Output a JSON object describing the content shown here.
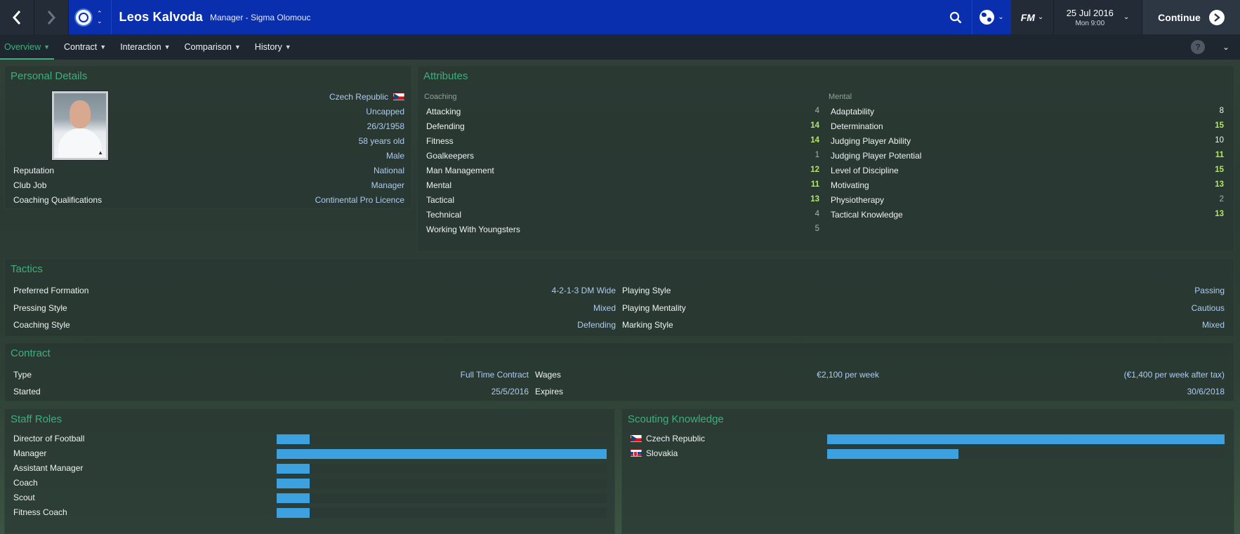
{
  "header": {
    "name": "Leos Kalvoda",
    "subtitle": "Manager - Sigma Olomouc",
    "date": "25 Jul 2016",
    "time": "Mon 9:00",
    "continue_label": "Continue",
    "fm_logo": "FM",
    "accent_color": "#0a2fae"
  },
  "tabs": [
    {
      "label": "Overview",
      "active": true
    },
    {
      "label": "Contract"
    },
    {
      "label": "Interaction"
    },
    {
      "label": "Comparison"
    },
    {
      "label": "History"
    }
  ],
  "help_label": "?",
  "personal": {
    "title": "Personal Details",
    "nationality": "Czech Republic",
    "caps": "Uncapped",
    "dob": "26/3/1958",
    "age": "58 years old",
    "gender": "Male",
    "rows": [
      {
        "label": "Reputation",
        "value": "National"
      },
      {
        "label": "Club Job",
        "value": "Manager"
      },
      {
        "label": "Coaching Qualifications",
        "value": "Continental Pro Licence"
      }
    ]
  },
  "attributes": {
    "title": "Attributes",
    "coaching_head": "Coaching",
    "mental_head": "Mental",
    "coaching": [
      {
        "label": "Attacking",
        "value": "4"
      },
      {
        "label": "Defending",
        "value": "14"
      },
      {
        "label": "Fitness",
        "value": "14"
      },
      {
        "label": "Goalkeepers",
        "value": "1"
      },
      {
        "label": "Man Management",
        "value": "12"
      },
      {
        "label": "Mental",
        "value": "11"
      },
      {
        "label": "Tactical",
        "value": "13"
      },
      {
        "label": "Technical",
        "value": "4"
      },
      {
        "label": "Working With Youngsters",
        "value": "5"
      }
    ],
    "mental": [
      {
        "label": "Adaptability",
        "value": "8"
      },
      {
        "label": "Determination",
        "value": "15"
      },
      {
        "label": "Judging Player Ability",
        "value": "10"
      },
      {
        "label": "Judging Player Potential",
        "value": "11"
      },
      {
        "label": "Level of Discipline",
        "value": "15"
      },
      {
        "label": "Motivating",
        "value": "13"
      },
      {
        "label": "Physiotherapy",
        "value": "2"
      },
      {
        "label": "Tactical Knowledge",
        "value": "13"
      }
    ]
  },
  "tactics": {
    "title": "Tactics",
    "left": [
      {
        "label": "Preferred Formation",
        "value": "4-2-1-3 DM Wide"
      },
      {
        "label": "Pressing Style",
        "value": "Mixed"
      },
      {
        "label": "Coaching Style",
        "value": "Defending"
      }
    ],
    "right": [
      {
        "label": "Playing Style",
        "value": "Passing"
      },
      {
        "label": "Playing Mentality",
        "value": "Cautious"
      },
      {
        "label": "Marking Style",
        "value": "Mixed"
      }
    ]
  },
  "contract": {
    "title": "Contract",
    "type_label": "Type",
    "type_value": "Full Time Contract",
    "started_label": "Started",
    "started_value": "25/5/2016",
    "wages_label": "Wages",
    "wages_value": "€2,100 per week",
    "wages_after_tax": "(€1,400 per week after tax)",
    "expires_label": "Expires",
    "expires_value": "30/6/2018"
  },
  "staff_roles": {
    "title": "Staff Roles",
    "bar_color": "#3ea1df",
    "items": [
      {
        "label": "Director of Football",
        "level": 0.1
      },
      {
        "label": "Manager",
        "level": 1.0
      },
      {
        "label": "Assistant Manager",
        "level": 0.1
      },
      {
        "label": "Coach",
        "level": 0.1
      },
      {
        "label": "Scout",
        "level": 0.1
      },
      {
        "label": "Fitness Coach",
        "level": 0.1
      }
    ]
  },
  "scouting": {
    "title": "Scouting Knowledge",
    "items": [
      {
        "label": "Czech Republic",
        "flag": "cz",
        "level": 1.0
      },
      {
        "label": "Slovakia",
        "flag": "sk",
        "level": 0.33
      }
    ]
  }
}
